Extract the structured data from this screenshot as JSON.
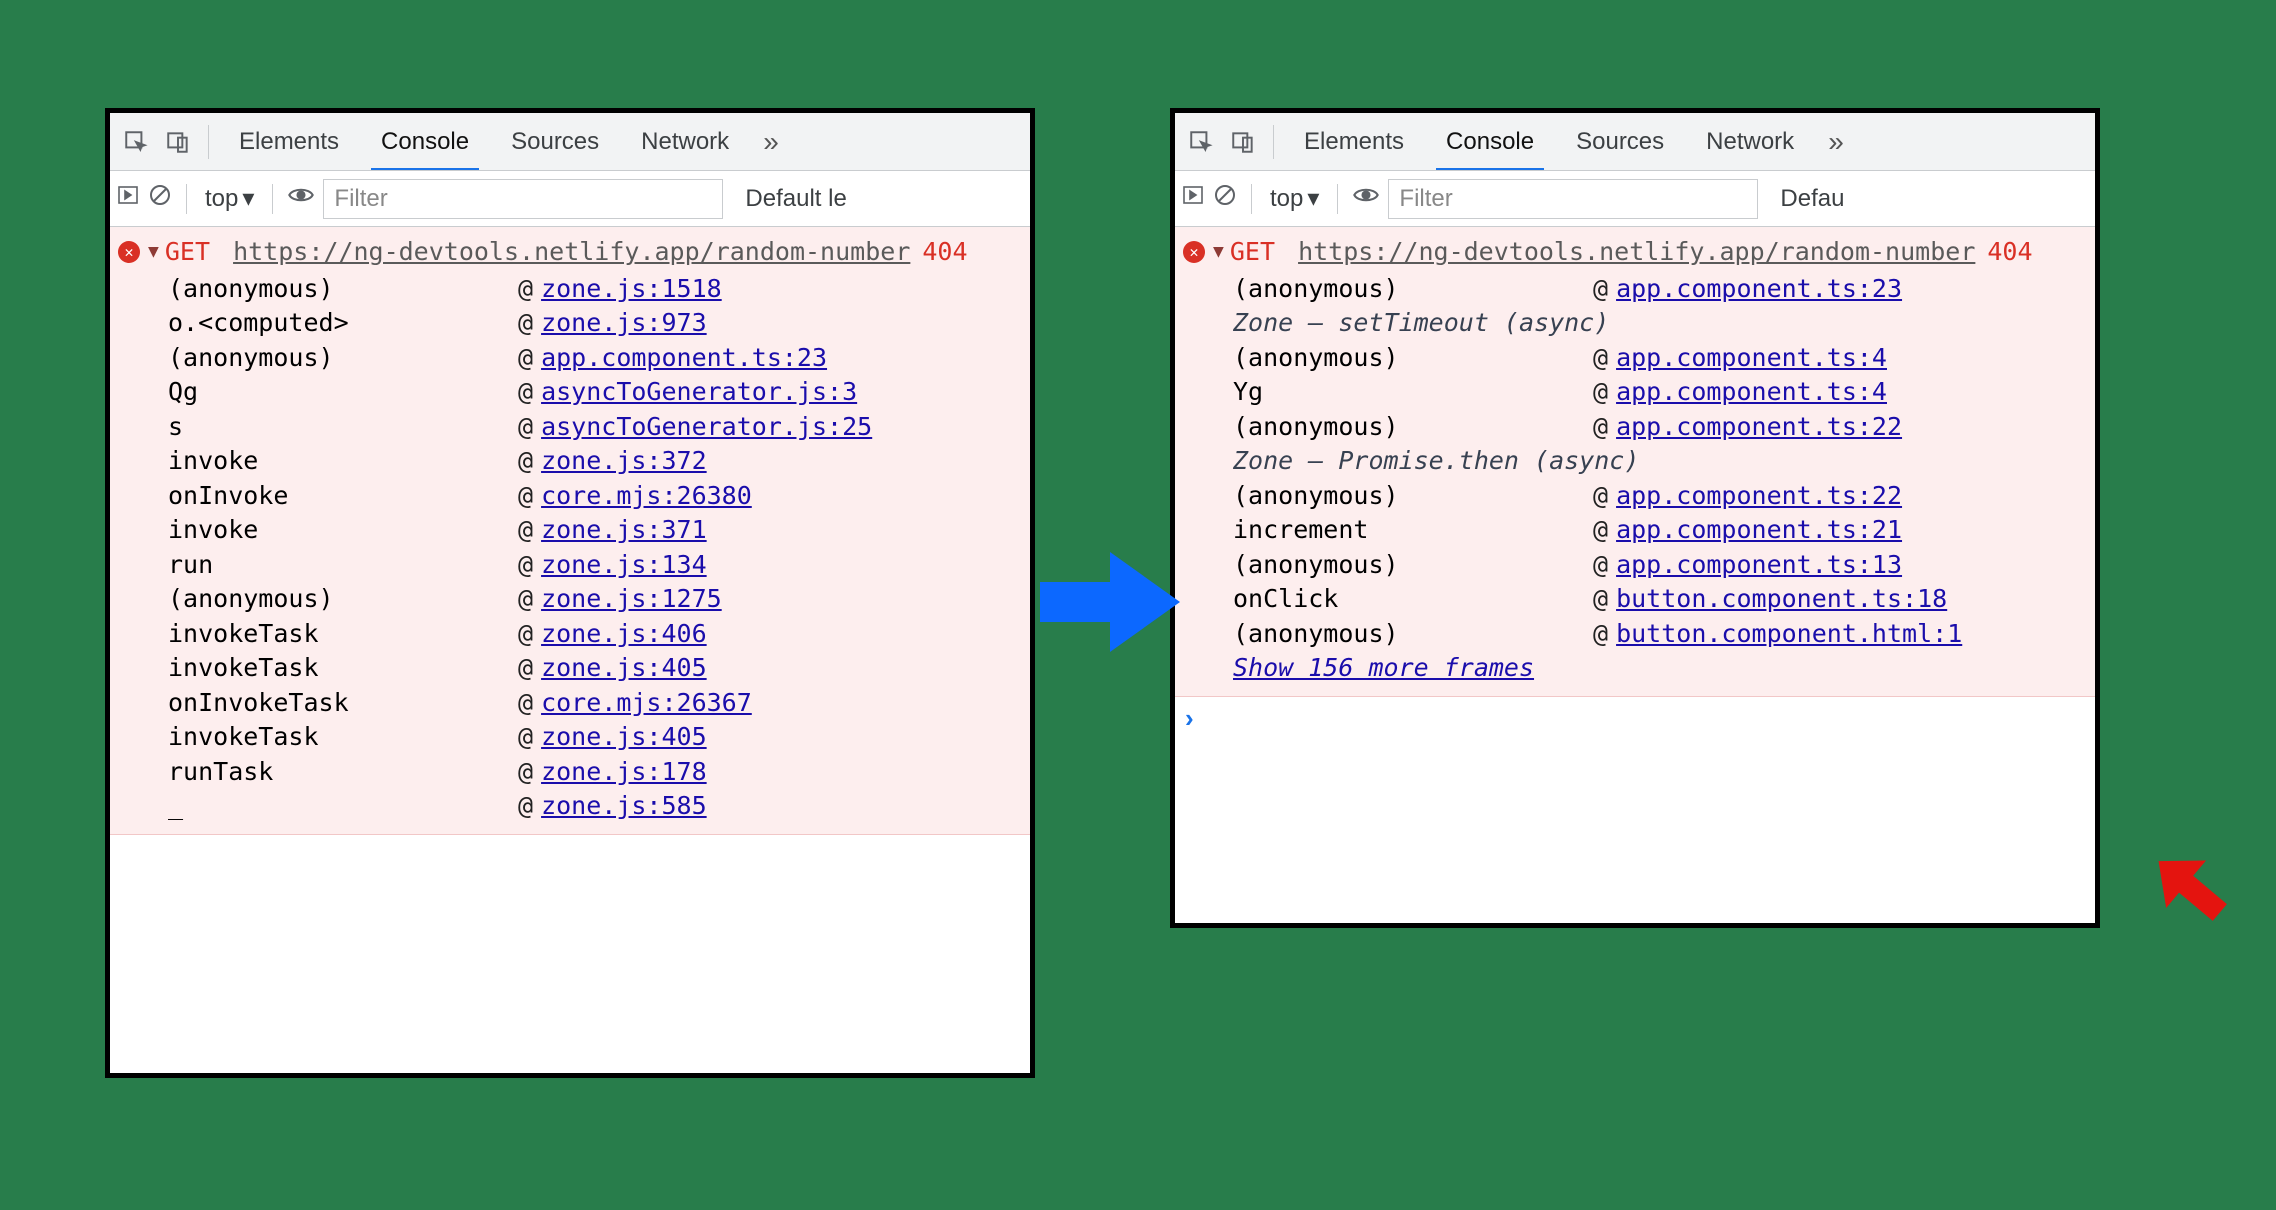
{
  "tabs": {
    "elements": "Elements",
    "console": "Console",
    "sources": "Sources",
    "network": "Network"
  },
  "toolbar": {
    "context": "top",
    "filter_placeholder": "Filter",
    "levels_left": "Default le",
    "levels_right": "Defau"
  },
  "error": {
    "method": "GET",
    "url": "https://ng-devtools.netlify.app/random-number",
    "status": "404"
  },
  "left_frames": [
    {
      "fn": "(anonymous)",
      "src": "zone.js:1518"
    },
    {
      "fn": "o.<computed>",
      "src": "zone.js:973"
    },
    {
      "fn": "(anonymous)",
      "src": "app.component.ts:23"
    },
    {
      "fn": "Qg",
      "src": "asyncToGenerator.js:3"
    },
    {
      "fn": "s",
      "src": "asyncToGenerator.js:25"
    },
    {
      "fn": "invoke",
      "src": "zone.js:372"
    },
    {
      "fn": "onInvoke",
      "src": "core.mjs:26380"
    },
    {
      "fn": "invoke",
      "src": "zone.js:371"
    },
    {
      "fn": "run",
      "src": "zone.js:134"
    },
    {
      "fn": "(anonymous)",
      "src": "zone.js:1275"
    },
    {
      "fn": "invokeTask",
      "src": "zone.js:406"
    },
    {
      "fn": "invokeTask",
      "src": "zone.js:405"
    },
    {
      "fn": "onInvokeTask",
      "src": "core.mjs:26367"
    },
    {
      "fn": "invokeTask",
      "src": "zone.js:405"
    },
    {
      "fn": "runTask",
      "src": "zone.js:178"
    },
    {
      "fn": "_",
      "src": "zone.js:585"
    }
  ],
  "right_groups": [
    {
      "header": null,
      "frames": [
        {
          "fn": "(anonymous)",
          "src": "app.component.ts:23"
        }
      ]
    },
    {
      "header": "Zone — setTimeout (async)",
      "frames": [
        {
          "fn": "(anonymous)",
          "src": "app.component.ts:4"
        },
        {
          "fn": "Yg",
          "src": "app.component.ts:4"
        },
        {
          "fn": "(anonymous)",
          "src": "app.component.ts:22"
        }
      ]
    },
    {
      "header": "Zone — Promise.then (async)",
      "frames": [
        {
          "fn": "(anonymous)",
          "src": "app.component.ts:22"
        },
        {
          "fn": "increment",
          "src": "app.component.ts:21"
        },
        {
          "fn": "(anonymous)",
          "src": "app.component.ts:13"
        },
        {
          "fn": "onClick",
          "src": "button.component.ts:18"
        },
        {
          "fn": "(anonymous)",
          "src": "button.component.html:1"
        }
      ]
    }
  ],
  "show_more": "Show 156 more frames"
}
